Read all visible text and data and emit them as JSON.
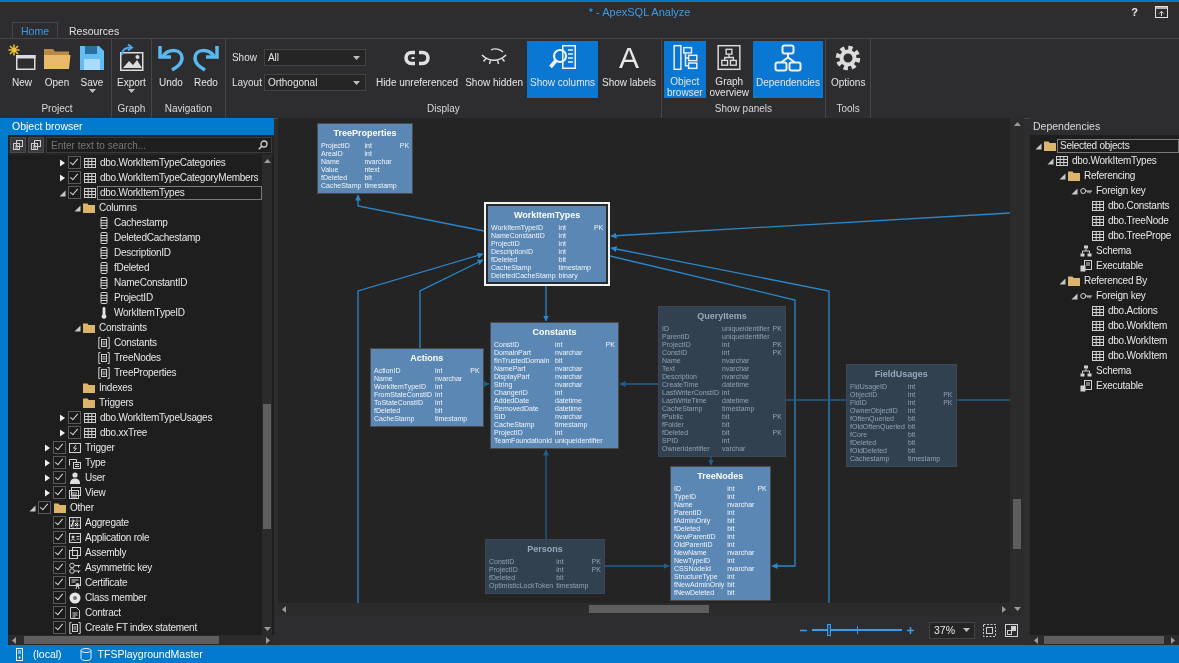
{
  "window": {
    "title": "* - ApexSQL Analyze",
    "help": "?"
  },
  "ribbon": {
    "tabs": [
      {
        "label": "Home",
        "selected": true
      },
      {
        "label": "Resources",
        "selected": false
      }
    ],
    "groups": [
      {
        "label": "Project",
        "buttons": [
          {
            "label": "New"
          },
          {
            "label": "Open"
          },
          {
            "label": "Save",
            "menu": true
          }
        ]
      },
      {
        "label": "Graph",
        "buttons": [
          {
            "label": "Export",
            "menu": true
          }
        ]
      },
      {
        "label": "Navigation",
        "buttons": [
          {
            "label": "Undo"
          },
          {
            "label": "Redo"
          }
        ]
      },
      {
        "label": "Display",
        "fields": [
          {
            "label": "Show",
            "value": "All"
          },
          {
            "label": "Layout",
            "value": "Orthogonal"
          }
        ],
        "buttons": [
          {
            "label": "Hide unreferenced",
            "on": false
          },
          {
            "label": "Show hidden",
            "on": false
          },
          {
            "label": "Show columns",
            "on": true
          },
          {
            "label": "Show labels",
            "glyph": "A",
            "on": false
          }
        ]
      },
      {
        "label": "Show panels",
        "buttons": [
          {
            "label": "Object browser",
            "on": true
          },
          {
            "label": "Graph overview",
            "on": false
          },
          {
            "label": "Dependencies",
            "on": true
          }
        ]
      },
      {
        "label": "Tools",
        "buttons": [
          {
            "label": "Options"
          }
        ]
      }
    ]
  },
  "object_browser": {
    "title": "Object browser",
    "search": {
      "placeholder": "Enter text to search..."
    },
    "tree": [
      {
        "children": [
          {
            "children": [
              {
                "label": "dbo.WorkItemTypeCategories",
                "kind": "table",
                "checked": true,
                "expanded": false,
                "selected": false
              },
              {
                "label": "dbo.WorkItemTypeCategoryMembers",
                "kind": "table",
                "checked": true,
                "expanded": false,
                "selected": false
              },
              {
                "label": "dbo.WorkItemTypes",
                "kind": "table",
                "checked": true,
                "expanded": true,
                "selected": true,
                "children": [
                  {
                    "label": "Columns",
                    "kind": "folder",
                    "expanded": true,
                    "selected": false,
                    "children": [
                      {
                        "label": "Cachestamp",
                        "kind": "column",
                        "selected": false
                      },
                      {
                        "label": "DeletedCachestamp",
                        "kind": "column",
                        "selected": false
                      },
                      {
                        "label": "DescriptionID",
                        "kind": "column",
                        "selected": false
                      },
                      {
                        "label": "fDeleted",
                        "kind": "column",
                        "selected": false
                      },
                      {
                        "label": "NameConstantID",
                        "kind": "column",
                        "selected": false
                      },
                      {
                        "label": "ProjectID",
                        "kind": "column",
                        "selected": false
                      },
                      {
                        "label": "WorkItemTypeID",
                        "kind": "primarykey",
                        "selected": false
                      }
                    ]
                  },
                  {
                    "label": "Constraints",
                    "kind": "folder",
                    "expanded": true,
                    "selected": false,
                    "children": [
                      {
                        "label": "Constants",
                        "kind": "constraint",
                        "selected": false
                      },
                      {
                        "label": "TreeNodes",
                        "kind": "constraint",
                        "selected": false
                      },
                      {
                        "label": "TreeProperties",
                        "kind": "constraint",
                        "selected": false
                      }
                    ]
                  },
                  {
                    "label": "Indexes",
                    "kind": "folder",
                    "selected": false
                  },
                  {
                    "label": "Triggers",
                    "kind": "folder",
                    "selected": false
                  }
                ]
              },
              {
                "label": "dbo.WorkItemTypeUsages",
                "kind": "table",
                "checked": true,
                "expanded": false,
                "selected": false
              },
              {
                "label": "dbo.xxTree",
                "kind": "table",
                "checked": true,
                "expanded": false,
                "selected": false
              }
            ]
          },
          {
            "label": "Trigger",
            "kind": "trigger",
            "checked": true,
            "expanded": false,
            "selected": false
          },
          {
            "label": "Type",
            "kind": "type",
            "checked": true,
            "expanded": false,
            "selected": false
          },
          {
            "label": "User",
            "kind": "user",
            "checked": true,
            "expanded": false,
            "selected": false
          },
          {
            "label": "View",
            "kind": "view",
            "checked": true,
            "expanded": false,
            "selected": false
          }
        ]
      },
      {
        "label": "Other",
        "kind": "folder",
        "checked": true,
        "expanded": true,
        "selected": false,
        "children": [
          {
            "label": "Aggregate",
            "kind": "aggregate",
            "checked": true,
            "selected": false
          },
          {
            "label": "Application role",
            "kind": "role",
            "checked": true,
            "selected": false
          },
          {
            "label": "Assembly",
            "kind": "assembly",
            "checked": true,
            "selected": false
          },
          {
            "label": "Asymmetric key",
            "kind": "asymmetrickey",
            "checked": true,
            "selected": false
          },
          {
            "label": "Certificate",
            "kind": "certificate",
            "checked": true,
            "selected": false
          },
          {
            "label": "Class member",
            "kind": "classmember",
            "checked": true,
            "selected": false
          },
          {
            "label": "Contract",
            "kind": "contract",
            "checked": true,
            "selected": false
          },
          {
            "label": "Create FT index statement",
            "kind": "statement",
            "checked": true,
            "selected": false
          }
        ]
      }
    ]
  },
  "diagram": {
    "nodes": [
      {
        "title": "TreeProperties",
        "selected": false,
        "dimmed": false,
        "columns": [
          {
            "name": "ProjectID",
            "type": "int",
            "key": "PK"
          },
          {
            "name": "AreaID",
            "type": "int"
          },
          {
            "name": "Name",
            "type": "nvarchar"
          },
          {
            "name": "Value",
            "type": "ntext"
          },
          {
            "name": "fDeleted",
            "type": "bit"
          },
          {
            "name": "CacheStamp",
            "type": "timestamp"
          }
        ]
      },
      {
        "title": "WorkItemTypes",
        "selected": true,
        "dimmed": false,
        "columns": [
          {
            "name": "WorkItemTypeID",
            "type": "int",
            "key": "PK"
          },
          {
            "name": "NameConstantID",
            "type": "int"
          },
          {
            "name": "ProjectID",
            "type": "int"
          },
          {
            "name": "DescriptionID",
            "type": "int"
          },
          {
            "name": "fDeleted",
            "type": "bit"
          },
          {
            "name": "CacheStamp",
            "type": "timestamp"
          },
          {
            "name": "DeletedCacheStamp",
            "type": "binary"
          }
        ]
      },
      {
        "title": "Actions",
        "selected": false,
        "dimmed": false,
        "columns": [
          {
            "name": "ActionID",
            "type": "int",
            "key": "PK"
          },
          {
            "name": "Name",
            "type": "nvarchar"
          },
          {
            "name": "WorkItemTypeID",
            "type": "int"
          },
          {
            "name": "FromStateConstID",
            "type": "int"
          },
          {
            "name": "ToStateConstID",
            "type": "int"
          },
          {
            "name": "fDeleted",
            "type": "bit"
          },
          {
            "name": "CacheStamp",
            "type": "timestamp"
          }
        ]
      },
      {
        "title": "Constants",
        "selected": false,
        "dimmed": false,
        "columns": [
          {
            "name": "ConstID",
            "type": "int",
            "key": "PK"
          },
          {
            "name": "DomainPart",
            "type": "nvarchar"
          },
          {
            "name": "fInTrustedDomain",
            "type": "bit"
          },
          {
            "name": "NamePart",
            "type": "nvarchar"
          },
          {
            "name": "DisplayPart",
            "type": "nvarchar"
          },
          {
            "name": "String",
            "type": "nvarchar"
          },
          {
            "name": "ChangerID",
            "type": "int"
          },
          {
            "name": "AddedDate",
            "type": "datetime"
          },
          {
            "name": "RemovedDate",
            "type": "datetime"
          },
          {
            "name": "SID",
            "type": "nvarchar"
          },
          {
            "name": "CacheStamp",
            "type": "timestamp"
          },
          {
            "name": "ProjectID",
            "type": "int"
          },
          {
            "name": "TeamFoundationId",
            "type": "uniqueidentifier"
          }
        ]
      },
      {
        "title": "QueryItems",
        "selected": false,
        "dimmed": true,
        "columns": [
          {
            "name": "ID",
            "type": "uniqueidentifier",
            "key": "PK"
          },
          {
            "name": "ParentID",
            "type": "uniqueidentifier"
          },
          {
            "name": "ProjectID",
            "type": "int",
            "key": "PK"
          },
          {
            "name": "ConstID",
            "type": "int",
            "key": "PK"
          },
          {
            "name": "Name",
            "type": "nvarchar"
          },
          {
            "name": "Text",
            "type": "nvarchar"
          },
          {
            "name": "Description",
            "type": "nvarchar"
          },
          {
            "name": "CreateTime",
            "type": "datetime"
          },
          {
            "name": "LastWriterConstID",
            "type": "int"
          },
          {
            "name": "LastWriteTime",
            "type": "datetime"
          },
          {
            "name": "CacheStamp",
            "type": "timestamp"
          },
          {
            "name": "fPublic",
            "type": "bit",
            "key": "PK"
          },
          {
            "name": "fFolder",
            "type": "bit"
          },
          {
            "name": "fDeleted",
            "type": "bit",
            "key": "PK"
          },
          {
            "name": "SPID",
            "type": "int"
          },
          {
            "name": "OwnerIdentifier",
            "type": "varchar"
          }
        ]
      },
      {
        "title": "FieldUsages",
        "selected": false,
        "dimmed": true,
        "columns": [
          {
            "name": "FldUsageID",
            "type": "int"
          },
          {
            "name": "ObjectID",
            "type": "int",
            "key": "PK"
          },
          {
            "name": "FldID",
            "type": "int",
            "key": "PK"
          },
          {
            "name": "OwnerObjectID",
            "type": "int"
          },
          {
            "name": "fOftenQueried",
            "type": "bit"
          },
          {
            "name": "fOldOftenQueried",
            "type": "bit"
          },
          {
            "name": "fCore",
            "type": "bit"
          },
          {
            "name": "fDeleted",
            "type": "bit"
          },
          {
            "name": "fOldDeleted",
            "type": "bit"
          },
          {
            "name": "Cachestamp",
            "type": "timestamp"
          }
        ]
      },
      {
        "title": "TreeNodes",
        "selected": false,
        "dimmed": false,
        "columns": [
          {
            "name": "ID",
            "type": "int",
            "key": "PK"
          },
          {
            "name": "TypeID",
            "type": "int"
          },
          {
            "name": "Name",
            "type": "nvarchar"
          },
          {
            "name": "ParentID",
            "type": "int"
          },
          {
            "name": "fAdminOnly",
            "type": "bit"
          },
          {
            "name": "fDeleted",
            "type": "bit"
          },
          {
            "name": "NewParentID",
            "type": "int"
          },
          {
            "name": "OldParentID",
            "type": "int"
          },
          {
            "name": "NewName",
            "type": "nvarchar"
          },
          {
            "name": "NewTypeID",
            "type": "int"
          },
          {
            "name": "CSSNodeId",
            "type": "nvarchar"
          },
          {
            "name": "StructureType",
            "type": "int"
          },
          {
            "name": "fNewAdminOnly",
            "type": "bit"
          },
          {
            "name": "fNewDeleted",
            "type": "bit"
          }
        ]
      },
      {
        "title": "Persons",
        "selected": false,
        "dimmed": true,
        "columns": [
          {
            "name": "ConstID",
            "type": "int",
            "key": "PK"
          },
          {
            "name": "ProjectID",
            "type": "int",
            "key": "PK"
          },
          {
            "name": "fDeleted",
            "type": "bit"
          },
          {
            "name": "OptimisticLockToken",
            "type": "timestamp"
          }
        ]
      }
    ],
    "zoom": {
      "level": 0.19,
      "value": "37%"
    }
  },
  "dependencies": {
    "title": "Dependencies",
    "tree": [
      {
        "label": "Selected objects",
        "kind": "folder",
        "expanded": true,
        "selected": true,
        "children": [
          {
            "label": "dbo.WorkItemTypes",
            "kind": "table",
            "expanded": true,
            "selected": false,
            "children": [
              {
                "label": "Referencing",
                "kind": "folder",
                "expanded": true,
                "selected": false,
                "children": [
                  {
                    "label": "Foreign key",
                    "kind": "foreignkey",
                    "expanded": true,
                    "selected": false,
                    "children": [
                      {
                        "label": "dbo.Constants",
                        "kind": "table",
                        "selected": false
                      },
                      {
                        "label": "dbo.TreeNode",
                        "kind": "table",
                        "selected": false
                      },
                      {
                        "label": "dbo.TreePrope",
                        "kind": "table",
                        "selected": false
                      }
                    ]
                  },
                  {
                    "label": "Schema",
                    "kind": "schema",
                    "selected": false
                  },
                  {
                    "label": "Executable",
                    "kind": "executable",
                    "selected": false
                  }
                ]
              },
              {
                "label": "Referenced By",
                "kind": "folder",
                "expanded": true,
                "selected": false,
                "children": [
                  {
                    "label": "Foreign key",
                    "kind": "foreignkey",
                    "expanded": true,
                    "selected": false,
                    "children": [
                      {
                        "label": "dbo.Actions",
                        "kind": "table",
                        "selected": false
                      },
                      {
                        "label": "dbo.WorkItem",
                        "kind": "table",
                        "selected": false
                      },
                      {
                        "label": "dbo.WorkItem",
                        "kind": "table",
                        "selected": false
                      },
                      {
                        "label": "dbo.WorkItem",
                        "kind": "table",
                        "selected": false
                      }
                    ]
                  },
                  {
                    "label": "Schema",
                    "kind": "schema",
                    "selected": false
                  },
                  {
                    "label": "Executable",
                    "kind": "executable",
                    "selected": false
                  }
                ]
              }
            ]
          }
        ]
      }
    ]
  },
  "status_bar": {
    "items": [
      {
        "kind": "server",
        "label": "(local)"
      },
      {
        "kind": "database",
        "label": "TFSPlaygroundMaster"
      }
    ]
  }
}
